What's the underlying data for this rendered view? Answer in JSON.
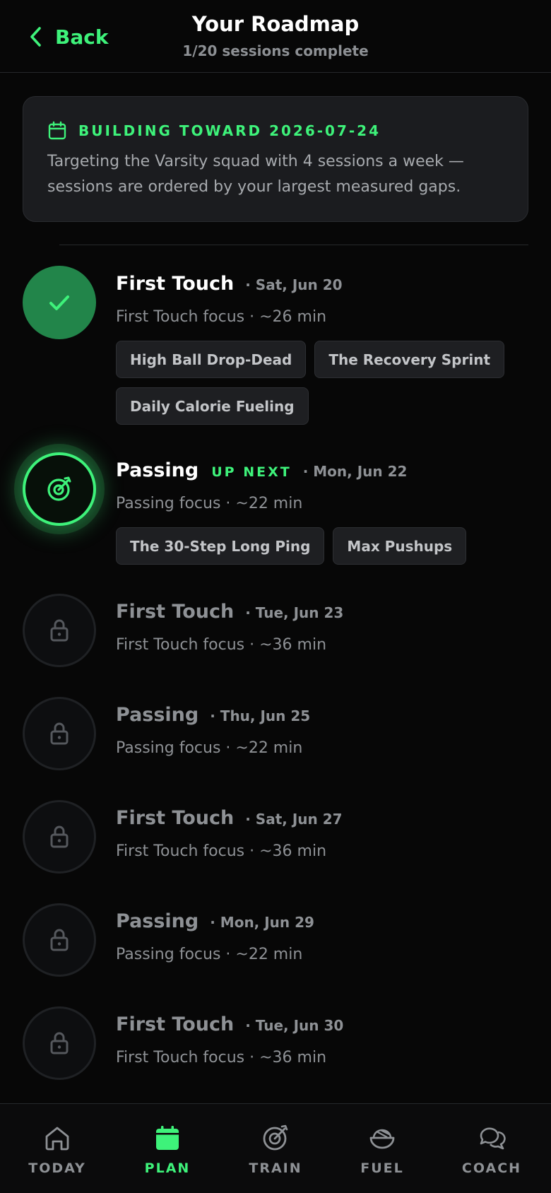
{
  "header": {
    "back_label": "Back",
    "title": "Your Roadmap",
    "subtitle": "1/20 sessions complete"
  },
  "goal_card": {
    "icon": "calendar-icon",
    "title": "BUILDING TOWARD 2026-07-24",
    "text": "Targeting the Varsity squad with 4 sessions a week — sessions are ordered by your largest measured gaps."
  },
  "sessions": [
    {
      "status": "done",
      "icon": "check-icon",
      "name": "First Touch",
      "date": "· Sat, Jun 20",
      "desc": "First Touch focus · ~26 min",
      "chips": [
        "High Ball Drop-Dead",
        "The Recovery Sprint",
        "Daily Calorie Fueling"
      ]
    },
    {
      "status": "next",
      "icon": "target-icon",
      "name": "Passing",
      "badge": "UP NEXT",
      "date": "· Mon, Jun 22",
      "desc": "Passing focus · ~22 min",
      "chips": [
        "The 30-Step Long Ping",
        "Max Pushups"
      ]
    },
    {
      "status": "locked",
      "icon": "lock-icon",
      "name": "First Touch",
      "date": "· Tue, Jun 23",
      "desc": "First Touch focus · ~36 min"
    },
    {
      "status": "locked",
      "icon": "lock-icon",
      "name": "Passing",
      "date": "· Thu, Jun 25",
      "desc": "Passing focus · ~22 min"
    },
    {
      "status": "locked",
      "icon": "lock-icon",
      "name": "First Touch",
      "date": "· Sat, Jun 27",
      "desc": "First Touch focus · ~36 min"
    },
    {
      "status": "locked",
      "icon": "lock-icon",
      "name": "Passing",
      "date": "· Mon, Jun 29",
      "desc": "Passing focus · ~22 min"
    },
    {
      "status": "locked",
      "icon": "lock-icon",
      "name": "First Touch",
      "date": "· Tue, Jun 30",
      "desc": "First Touch focus · ~36 min"
    }
  ],
  "nav": {
    "today": {
      "label": "TODAY",
      "icon": "home-icon"
    },
    "plan": {
      "label": "PLAN",
      "icon": "calendar-icon",
      "active": true
    },
    "train": {
      "label": "TRAIN",
      "icon": "target-icon"
    },
    "fuel": {
      "label": "FUEL",
      "icon": "food-bowl-icon"
    },
    "coach": {
      "label": "COACH",
      "icon": "chat-bubbles-icon"
    }
  },
  "colors": {
    "accent": "#3ef27a",
    "done": "#22854a",
    "background": "#070707",
    "card": "#1b1c1f",
    "muted": "#8e9195"
  }
}
